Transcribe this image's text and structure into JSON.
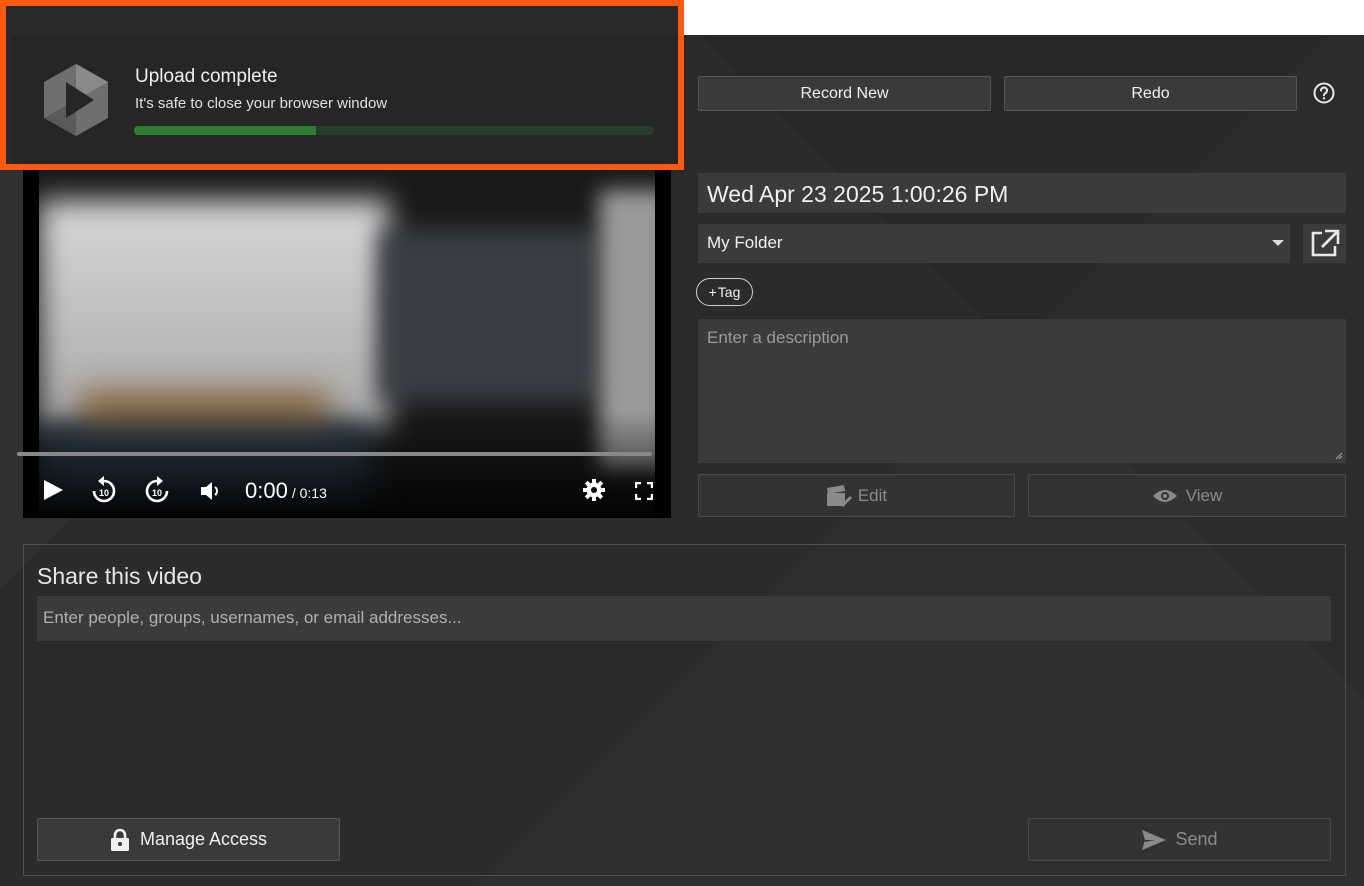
{
  "toast": {
    "title": "Upload complete",
    "subtitle": "It's safe to close your browser window",
    "progress": 0.35,
    "logo_icon": "panopto-logo-icon",
    "highlight_color": "#ff5a0f"
  },
  "top_buttons": {
    "record_new": "Record New",
    "redo": "Redo",
    "help_icon": "help-circle-icon"
  },
  "player": {
    "current_time": "0:00",
    "duration": "/ 0:13",
    "icons": [
      "play-icon",
      "rewind-10-icon",
      "forward-10-icon",
      "volume-icon",
      "settings-gear-icon",
      "fullscreen-icon"
    ]
  },
  "session": {
    "title": "Wed Apr 23 2025 1:00:26 PM",
    "folder": "My Folder",
    "tag_label": "Tag",
    "description_placeholder": "Enter a description",
    "edit_label": "Edit",
    "view_label": "View"
  },
  "share": {
    "title": "Share this video",
    "input_placeholder": "Enter people, groups, usernames, or email addresses...",
    "manage_access": "Manage Access",
    "send": "Send"
  },
  "colors": {
    "background": "#2b2b2b",
    "field": "#3b3b3b",
    "progress": "#2e7d32"
  }
}
